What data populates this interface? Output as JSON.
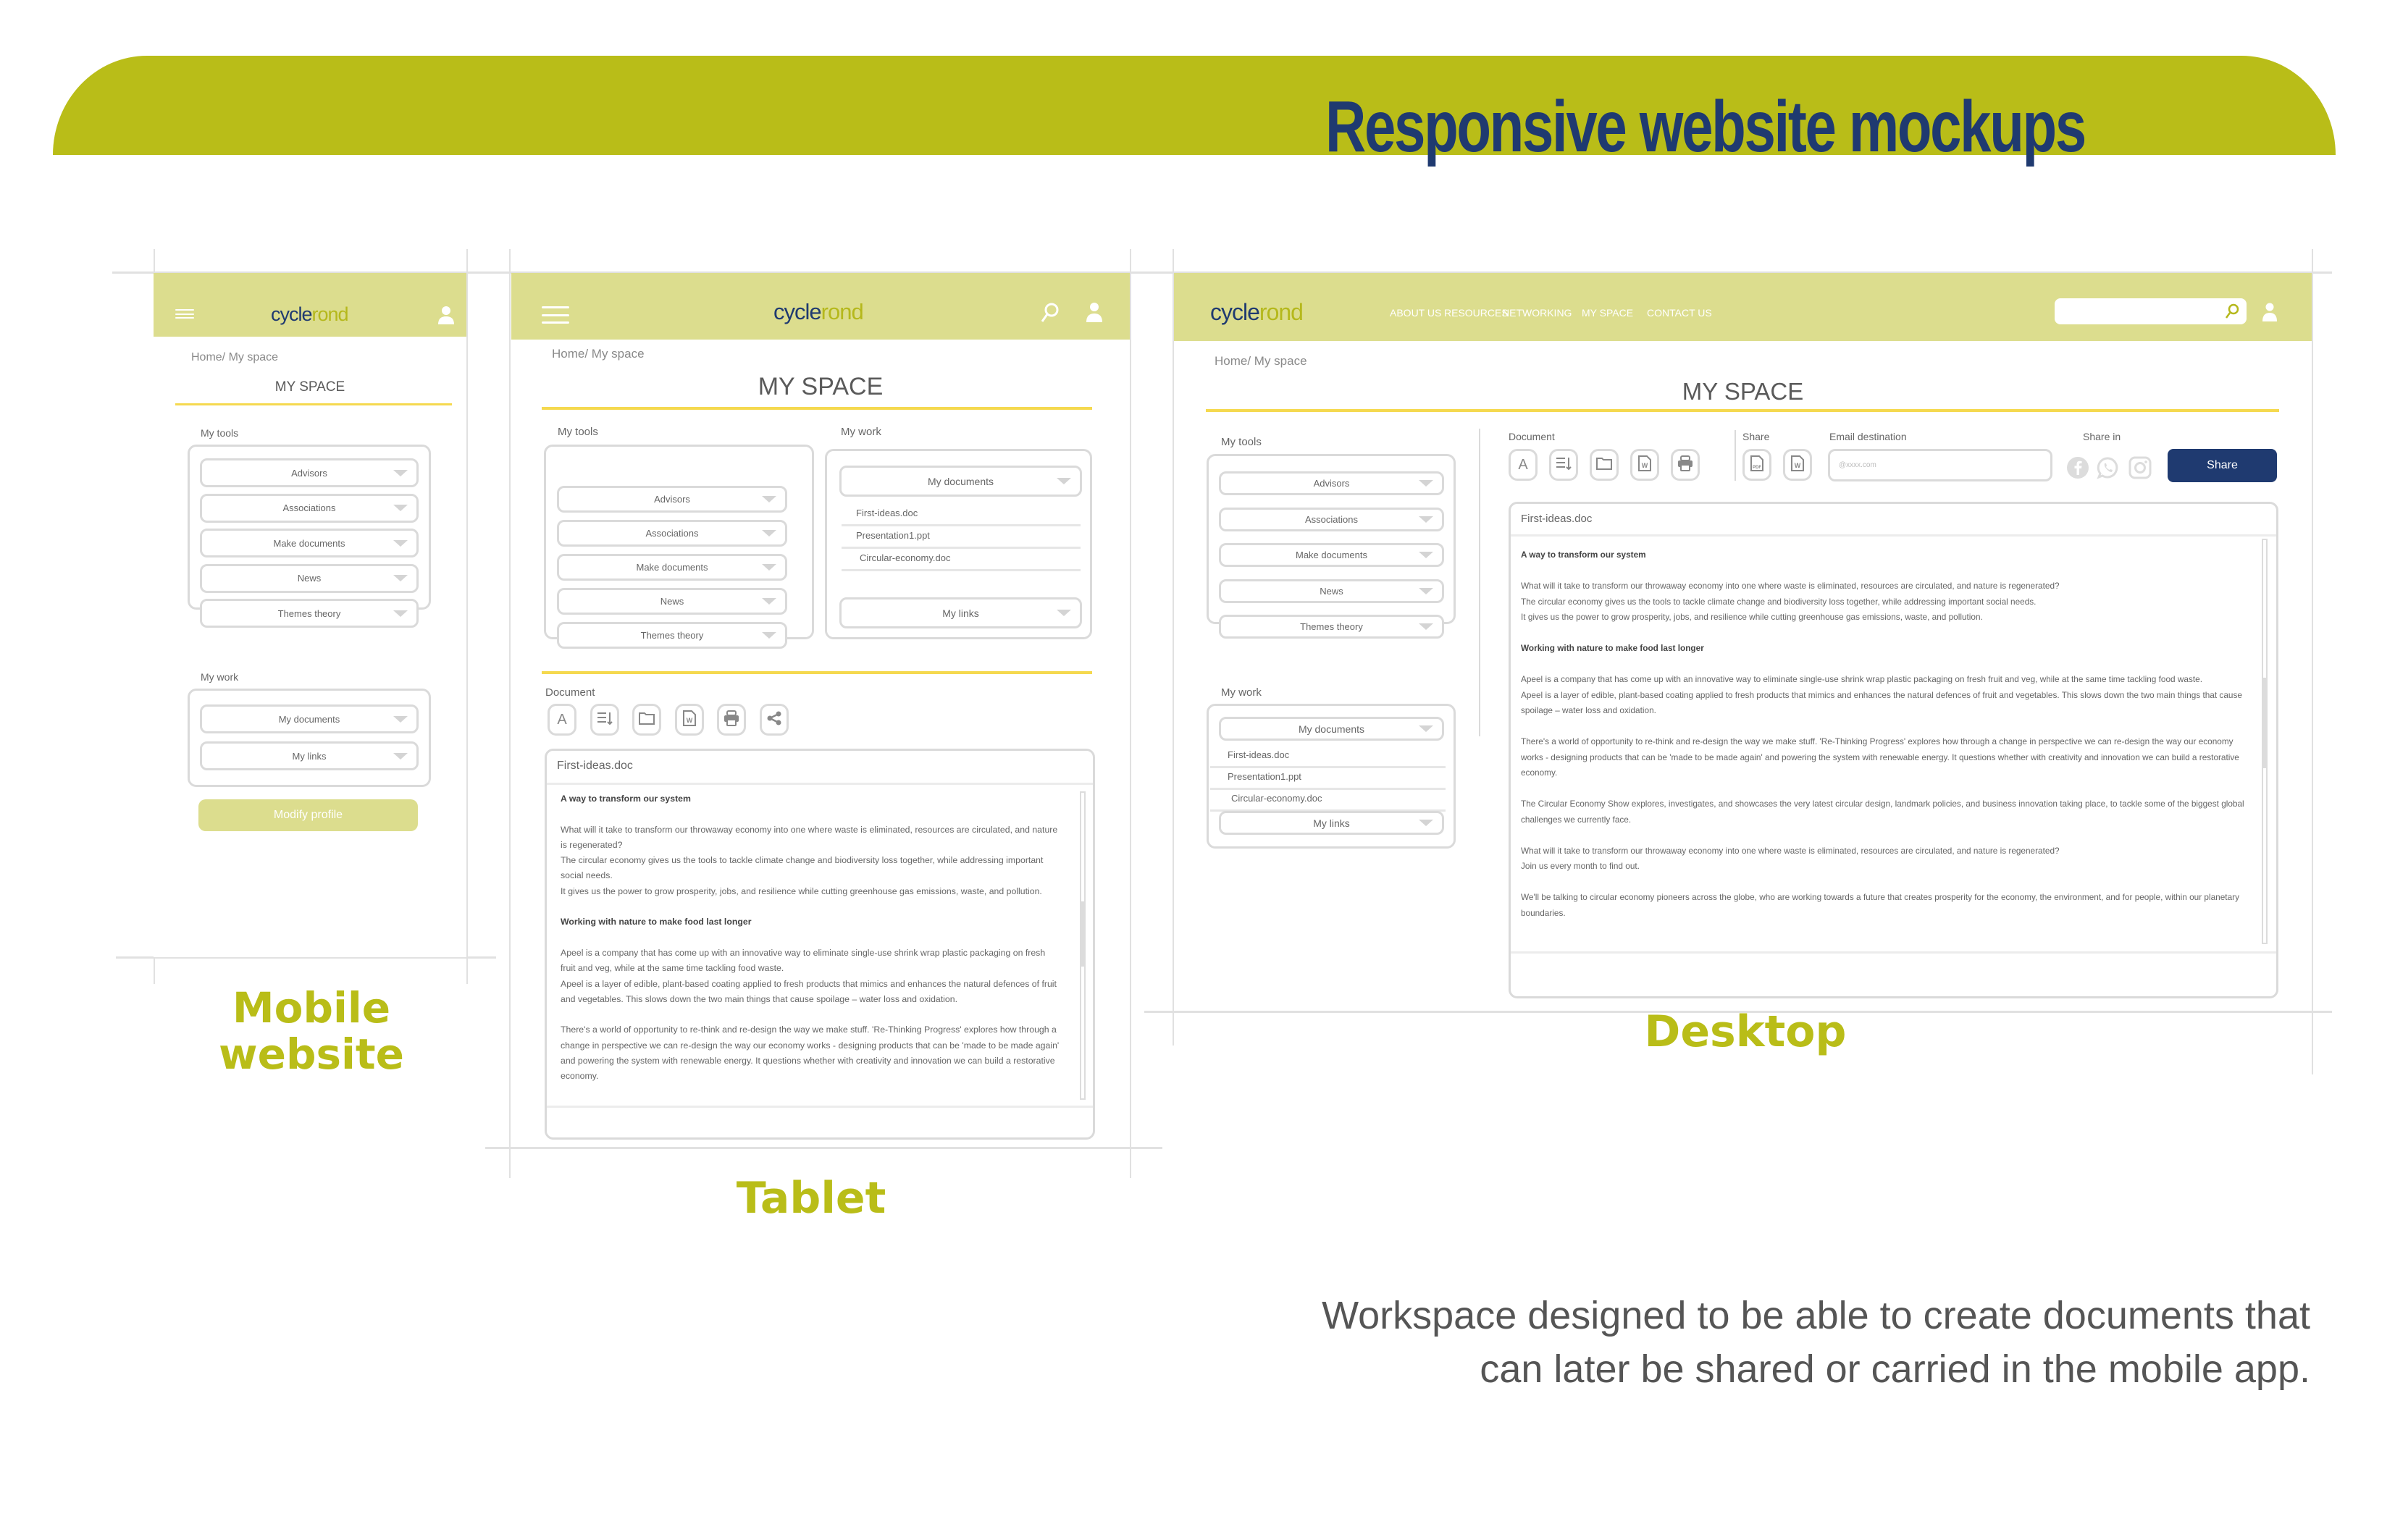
{
  "banner": {
    "title": "Responsive website mockups"
  },
  "brand": {
    "logo_part1": "cycle",
    "logo_part2": "rond",
    "primary": "#1f3a70",
    "accent": "#b9bd18",
    "nav_bg": "#dcdd8e",
    "title_underline": "#f5d94f"
  },
  "common": {
    "breadcrumb": "Home/ My space",
    "page_title": "MY SPACE",
    "my_tools_label": "My tools",
    "my_work_label": "My work",
    "tools": [
      "Advisors",
      "Associations",
      "Make documents",
      "News",
      "Themes theory"
    ],
    "my_documents": "My documents",
    "my_links": "My links",
    "documents": [
      "First-ideas.doc",
      "Presentation1.ppt",
      "Circular-economy.doc"
    ],
    "document_label": "Document",
    "icons": {
      "user": "user-icon",
      "menu": "hamburger-menu-icon",
      "search": "search-icon",
      "font": "font-icon",
      "sort": "sort-lines-icon",
      "folder": "folder-icon",
      "word": "word-file-icon",
      "print": "printer-icon",
      "share": "share-icon",
      "pdf": "pdf-file-icon",
      "facebook": "facebook-icon",
      "whatsapp": "whatsapp-icon",
      "instagram": "instagram-icon",
      "caret": "chevron-down-icon"
    }
  },
  "mobile": {
    "modify_profile": "Modify profile",
    "label_line1": "Mobile",
    "label_line2": "website"
  },
  "tablet": {
    "label": "Tablet"
  },
  "desktop": {
    "label": "Desktop",
    "nav": [
      "ABOUT US",
      "RESOURCES",
      "NETWORKING",
      "MY SPACE",
      "CONTACT US"
    ],
    "search_placeholder": "",
    "share_label": "Share",
    "email_label": "Email destination",
    "email_placeholder": "@xxxx.com",
    "share_in_label": "Share in",
    "share_button": "Share"
  },
  "editor": {
    "filename": "First-ideas.doc",
    "heading1": "A way to transform our system",
    "p1": "What will it take to transform our throwaway economy into one where waste is eliminated, resources are circulated, and nature is regenerated?",
    "p2": "The circular economy gives us the tools to tackle climate change and biodiversity loss together, while addressing important social needs.",
    "p3": "It gives us the power to grow prosperity, jobs, and resilience while cutting greenhouse gas emissions, waste, and pollution.",
    "heading2": "Working with nature to make food last longer",
    "p4": "Apeel is a company that has come up with an innovative way to eliminate single-use shrink wrap plastic packaging on fresh fruit and veg, while at the same time tackling food waste.",
    "p5": "Apeel is a layer of edible, plant-based coating applied to fresh products that mimics and enhances the natural defences of fruit and vegetables. This slows down the two main things that cause spoilage – water loss and oxidation.",
    "p6": "There's a world of opportunity to re-think and re-design the way we make stuff. 'Re-Thinking Progress' explores how through a change in perspective we can re-design the way our economy works - designing products that can be 'made to be made again' and powering the system with renewable energy. It questions whether with creativity and innovation we can build a restorative economy.",
    "p7": "The Circular Economy Show explores, investigates, and showcases the very latest circular design, landmark policies, and business innovation taking place, to tackle some of the biggest global challenges we currently face.",
    "p8": "What will it take to transform our throwaway economy into one where waste is eliminated, resources are circulated, and nature is regenerated?",
    "p9": "Join us every month to find out.",
    "p10": "We'll be talking to circular economy pioneers across the globe, who are working towards a future that creates prosperity for the economy, the environment, and for people, within our planetary boundaries."
  },
  "caption": {
    "line1": "Workspace designed to be able to create documents that",
    "line2": "can later be shared or carried in the mobile app."
  }
}
